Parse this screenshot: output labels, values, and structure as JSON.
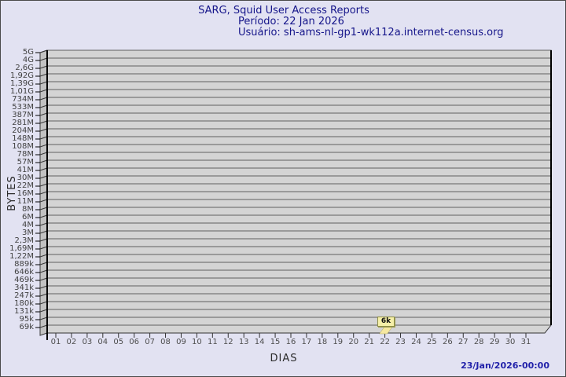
{
  "window": {
    "background": "#e2e2f2",
    "border_color": "#4a4a4a"
  },
  "header": {
    "title": "SARG, Squid User Access Reports",
    "period": "Período: 22 Jan 2026",
    "user": "Usuário: sh-ams-nl-gp1-wk112a.internet-census.org"
  },
  "chart_data": {
    "type": "bar",
    "title": "SARG, Squid User Access Reports",
    "subtitle": "Período: 22 Jan 2026",
    "user_line": "Usuário: sh-ams-nl-gp1-wk112a.internet-census.org",
    "xlabel": "DIAS",
    "ylabel": "BYTES",
    "y_scale": "logarithmic-like",
    "grid": true,
    "legend_position": "none",
    "categories": [
      "01",
      "02",
      "03",
      "04",
      "05",
      "06",
      "07",
      "08",
      "09",
      "10",
      "11",
      "12",
      "13",
      "14",
      "15",
      "16",
      "17",
      "18",
      "19",
      "20",
      "21",
      "22",
      "23",
      "24",
      "25",
      "26",
      "27",
      "28",
      "29",
      "30",
      "31"
    ],
    "values": [
      0,
      0,
      0,
      0,
      0,
      0,
      0,
      0,
      0,
      0,
      0,
      0,
      0,
      0,
      0,
      0,
      0,
      0,
      0,
      0,
      0,
      6000,
      0,
      0,
      0,
      0,
      0,
      0,
      0,
      0,
      0
    ],
    "point_label": {
      "day": "22",
      "text": "6k"
    },
    "y_tick_labels": [
      "5G",
      "4G",
      "2,6G",
      "1,92G",
      "1,39G",
      "1,01G",
      "734M",
      "533M",
      "387M",
      "281M",
      "204M",
      "148M",
      "108M",
      "78M",
      "57M",
      "41M",
      "30M",
      "22M",
      "16M",
      "11M",
      "8M",
      "6M",
      "4M",
      "3M",
      "2,3M",
      "1,69M",
      "1,22M",
      "889k",
      "646k",
      "469k",
      "341k",
      "247k",
      "180k",
      "131k",
      "95k",
      "69k"
    ],
    "colors": {
      "band": "#d4d4d4",
      "grid_line": "#606060",
      "wall": "#c2c2c2",
      "wall_line": "#3a3a3a",
      "axis": "#000000",
      "bar": "#f6e8a0",
      "label_box_bg": "#f5efa8",
      "label_box_border": "#8f8f46",
      "title_color": "#15158a",
      "tick_label_color": "#404040"
    }
  },
  "footer": {
    "timestamp": "23/Jan/2026-00:00"
  }
}
